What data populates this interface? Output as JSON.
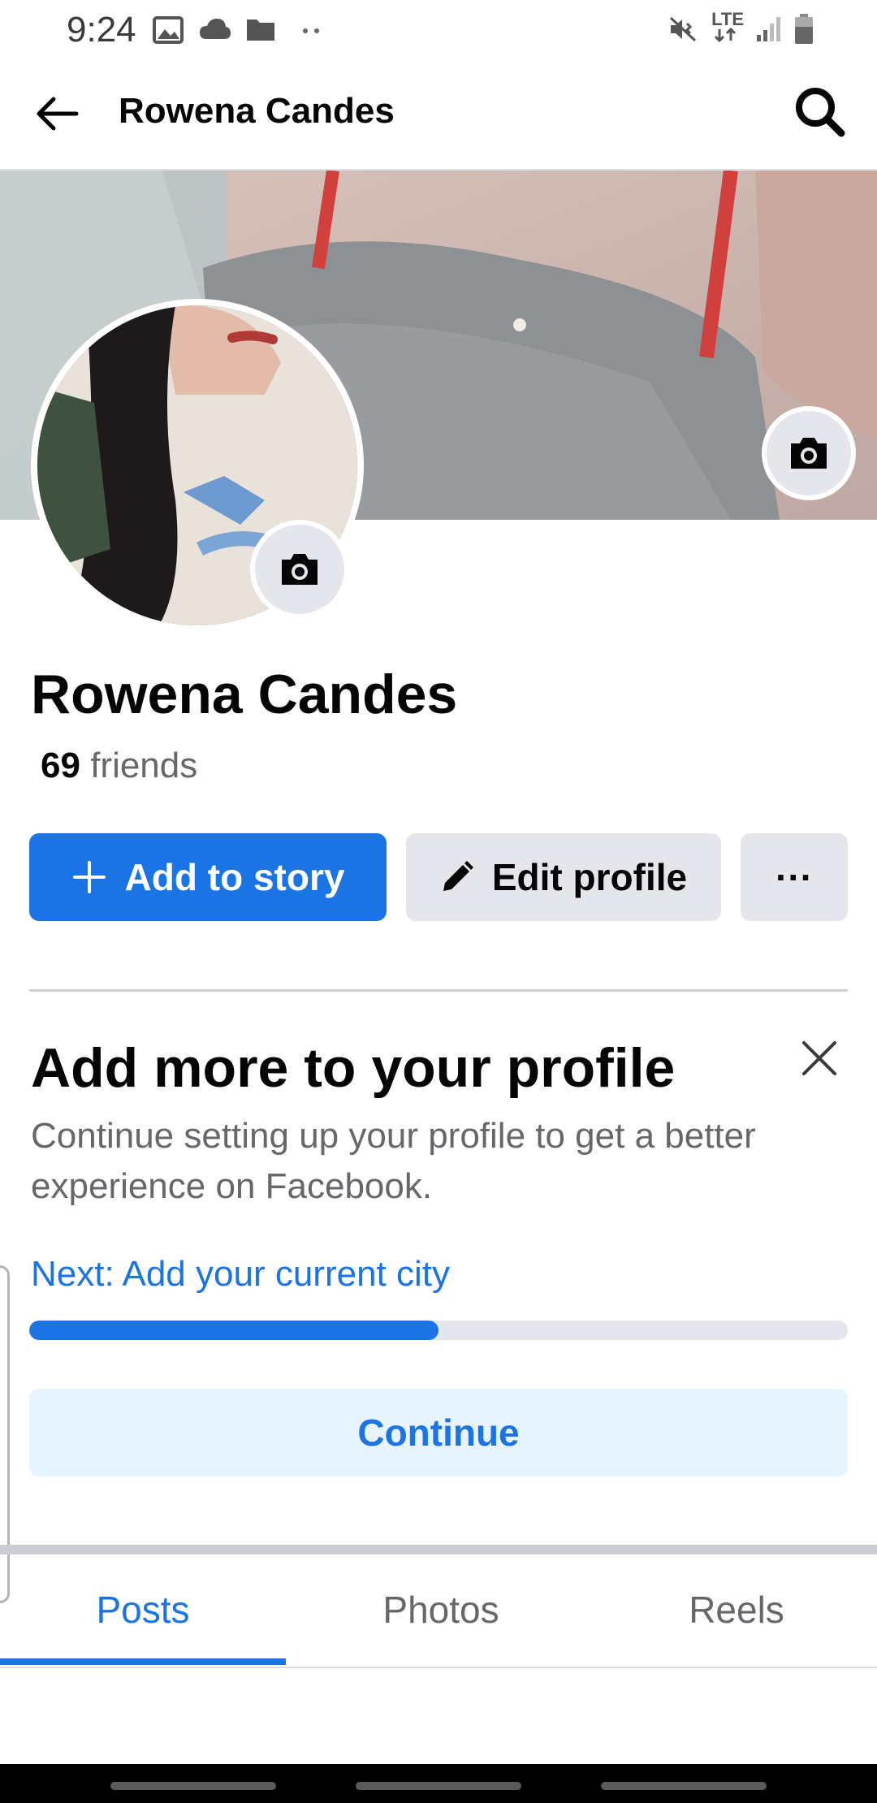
{
  "status_bar": {
    "time": "9:24",
    "network": "LTE"
  },
  "header": {
    "title": "Rowena Candes"
  },
  "profile": {
    "name": "Rowena Candes",
    "friends_count": "69",
    "friends_label": "friends"
  },
  "actions": {
    "add_story": "Add to story",
    "edit_profile": "Edit profile",
    "more": "···"
  },
  "card": {
    "title": "Add more to your profile",
    "description": "Continue setting up your profile to get a better experience on Facebook.",
    "next": "Next: Add your current city",
    "progress": 0.5,
    "continue": "Continue"
  },
  "tabs": [
    {
      "label": "Posts"
    },
    {
      "label": "Photos"
    },
    {
      "label": "Reels"
    }
  ],
  "colors": {
    "accent": "#1b74e4",
    "button_gray": "#e4e6eb",
    "continue_bg": "#e7f3ff",
    "text_muted": "#65676b"
  }
}
